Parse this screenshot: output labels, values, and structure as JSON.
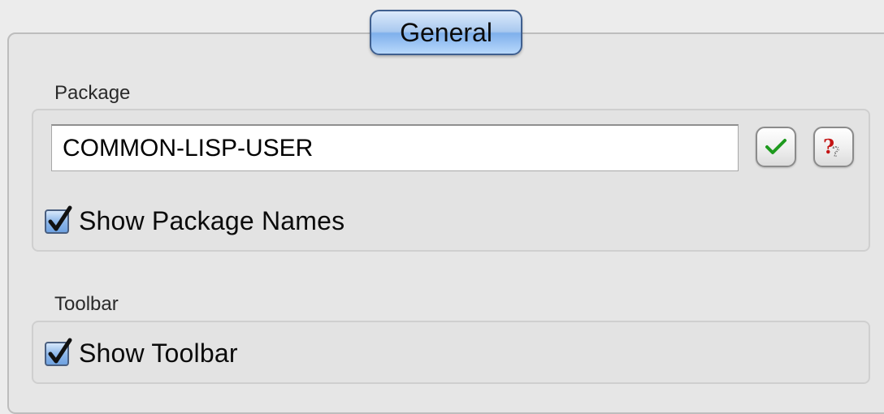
{
  "tabs": {
    "general_label": "General"
  },
  "package_section": {
    "title": "Package",
    "package_value": "COMMON-LISP-USER",
    "apply_icon": "checkmark-icon",
    "help_icon": "question-mark-icon",
    "show_package_names": {
      "label": "Show Package Names",
      "checked": true
    }
  },
  "toolbar_section": {
    "title": "Toolbar",
    "show_toolbar": {
      "label": "Show Toolbar",
      "checked": true
    }
  },
  "colors": {
    "tab_accent": "#7fb0ec",
    "check_green": "#1e9a1e",
    "help_red": "#c41414"
  }
}
